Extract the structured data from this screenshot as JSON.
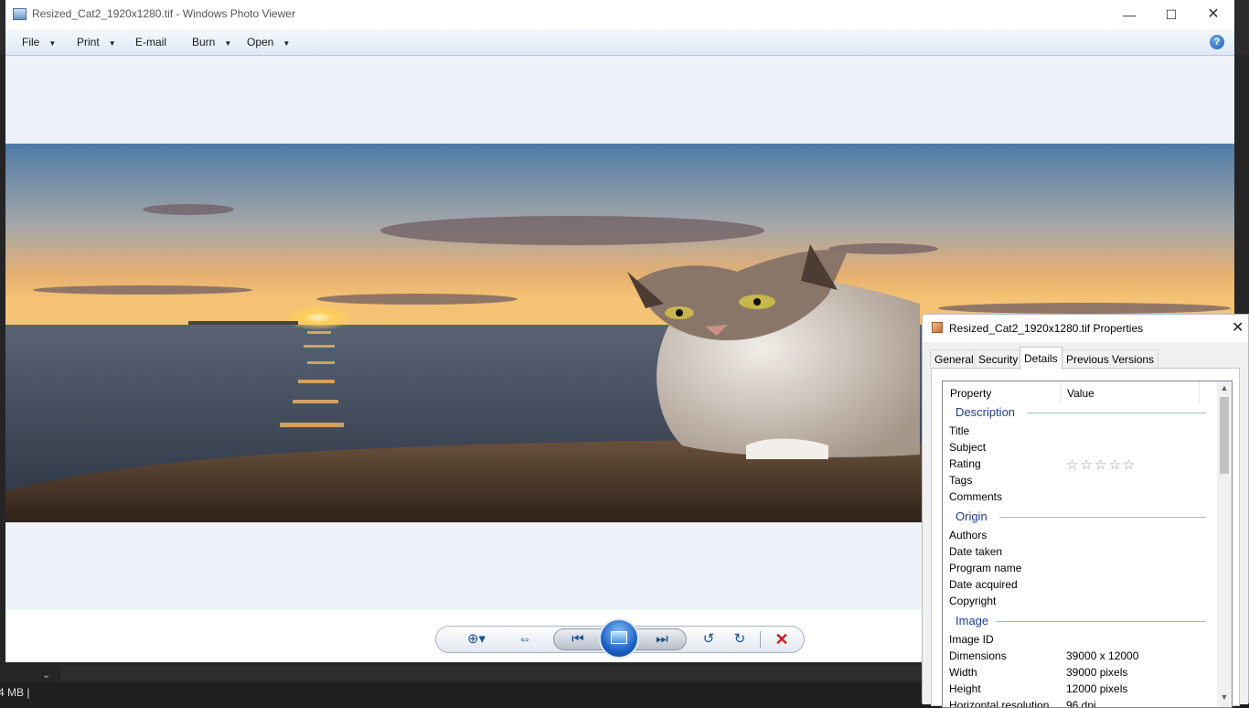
{
  "window": {
    "title": "Resized_Cat2_1920x1280.tif - Windows Photo Viewer",
    "minimize": "—",
    "maximize": "☐",
    "close": "✕"
  },
  "menu": {
    "file": "File",
    "print": "Print",
    "email": "E-mail",
    "burn": "Burn",
    "open": "Open",
    "help": "?"
  },
  "background_app": {
    "status_text": "4 MB |"
  },
  "properties": {
    "title": "Resized_Cat2_1920x1280.tif Properties",
    "close": "✕",
    "tabs": [
      "General",
      "Security",
      "Details",
      "Previous Versions"
    ],
    "header": {
      "property": "Property",
      "value": "Value"
    },
    "groups": {
      "description": "Description",
      "origin": "Origin",
      "image": "Image"
    },
    "rows": {
      "title": "Title",
      "subject": "Subject",
      "rating": "Rating",
      "rating_stars": "☆☆☆☆☆",
      "tags": "Tags",
      "comments": "Comments",
      "authors": "Authors",
      "date_taken": "Date taken",
      "program_name": "Program name",
      "date_acquired": "Date acquired",
      "copyright": "Copyright",
      "image_id": "Image ID",
      "dimensions": "Dimensions",
      "dimensions_value": "39000 x 12000",
      "width": "Width",
      "width_value": "39000 pixels",
      "height": "Height",
      "height_value": "12000 pixels",
      "hres": "Horizontal resolution",
      "hres_value": "96 dpi"
    }
  },
  "colors": {
    "accent_blue": "#1e3d8f",
    "delete_red": "#c81e1e"
  }
}
